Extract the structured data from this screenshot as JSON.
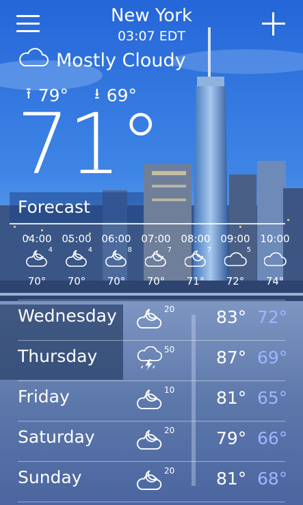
{
  "header": {
    "city": "New York",
    "time": "03:07 EDT"
  },
  "current": {
    "condition": "Mostly Cloudy",
    "high": "79°",
    "low": "69°",
    "temperature": "71°"
  },
  "forecast_label": "Forecast",
  "hourly": [
    {
      "time": "04:00",
      "icon": "night-cloudy-icon",
      "precip": "4",
      "temp": "70°"
    },
    {
      "time": "05:00",
      "icon": "night-cloudy-icon",
      "precip": "4",
      "temp": "70°"
    },
    {
      "time": "06:00",
      "icon": "night-cloudy-icon",
      "precip": "8",
      "temp": "70°"
    },
    {
      "time": "07:00",
      "icon": "partly-cloudy-icon",
      "precip": "7",
      "temp": "70°"
    },
    {
      "time": "08:00",
      "icon": "partly-cloudy-icon",
      "precip": "7",
      "temp": "71°"
    },
    {
      "time": "09:00",
      "icon": "cloudy-icon",
      "precip": "5",
      "temp": "72°"
    },
    {
      "time": "10:00",
      "icon": "cloudy-icon",
      "precip": "",
      "temp": "74°"
    }
  ],
  "daily": [
    {
      "day": "Wednesday",
      "icon": "night-cloudy-icon",
      "precip": "20",
      "high": "83°",
      "low": "72°"
    },
    {
      "day": "Thursday",
      "icon": "thunderstorm-icon",
      "precip": "50",
      "high": "87°",
      "low": "69°"
    },
    {
      "day": "Friday",
      "icon": "night-cloudy-icon",
      "precip": "10",
      "high": "81°",
      "low": "65°"
    },
    {
      "day": "Saturday",
      "icon": "night-cloudy-icon",
      "precip": "20",
      "high": "79°",
      "low": "66°"
    },
    {
      "day": "Sunday",
      "icon": "night-cloudy-icon",
      "precip": "20",
      "high": "81°",
      "low": "68°"
    }
  ],
  "colors": {
    "low_temp": "#9db6ff",
    "sky_top": "#2d6fd6",
    "water": "#6f86b4"
  }
}
